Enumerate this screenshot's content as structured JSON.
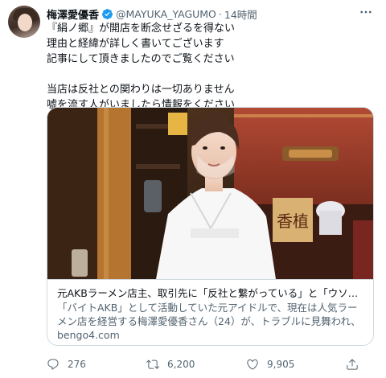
{
  "tweet": {
    "display_name": "梅澤愛優香",
    "handle": "@MAYUKA_YAGUMO",
    "separator": "·",
    "time": "14時間",
    "body_lines": [
      "『絹ノ郷』が開店を断念せざるを得ない",
      "理由と経緯が詳しく書いてございます",
      "記事にして頂きましたのでご覧ください",
      "",
      "当店は反社との関わりは一切ありません",
      "嘘を流す人がいましたら情報をください"
    ]
  },
  "card": {
    "title": "元AKBラーメン店主、取引先に「反社と繋がっている」と「ウソ」の…",
    "description": "「バイトAKB」として活動していた元アイドルで、現在は人気ラーメン店を経営する梅澤愛優香さん（24）が、トラブルに見舞われ、今秋に…",
    "domain": "bengo4.com",
    "image_sign_text": "香植"
  },
  "actions": {
    "reply_count": "276",
    "retweet_count": "6,200",
    "like_count": "9,905"
  },
  "colors": {
    "verified": "#1d9bf0",
    "secondary_text": "#536471",
    "border": "#cfd9de"
  }
}
